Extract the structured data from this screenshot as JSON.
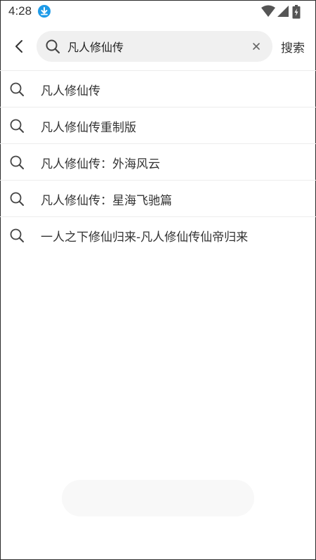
{
  "status_bar": {
    "time": "4:28",
    "icons": [
      "download-icon",
      "wifi-icon",
      "signal-icon",
      "battery-charging-icon"
    ],
    "accent": "#1e9be8"
  },
  "search": {
    "value": "凡人修仙传",
    "submit_label": "搜索"
  },
  "suggestions": [
    {
      "label": "凡人修仙传"
    },
    {
      "label": "凡人修仙传重制版"
    },
    {
      "label": "凡人修仙传：外海风云"
    },
    {
      "label": "凡人修仙传：星海飞驰篇"
    },
    {
      "label": "一人之下修仙归来-凡人修仙传仙帝归来"
    }
  ]
}
